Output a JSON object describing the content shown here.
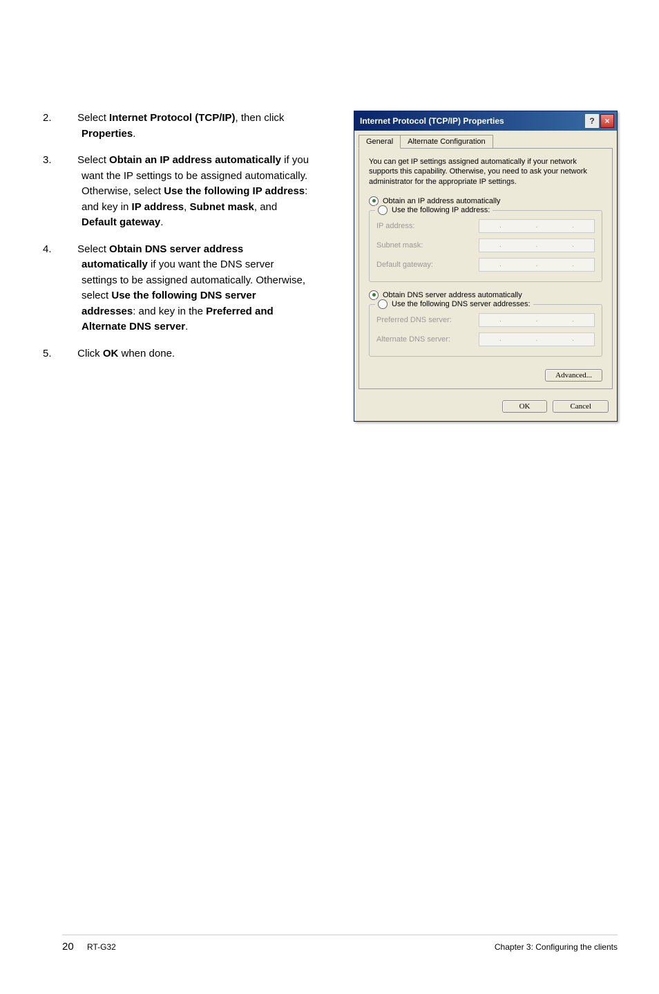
{
  "instructions": {
    "items": [
      {
        "num": "2.",
        "text": "Select <b>Internet Protocol (TCP/IP)</b>, then click <b>Properties</b>."
      },
      {
        "num": "3.",
        "text": "Select <b>Obtain an IP address automatically</b> if you want the IP settings to be assigned automatically. Otherwise, select <b>Use the following IP address</b>: and key in <b>IP address</b>, <b>Subnet mask</b>, and <b>Default gateway</b>."
      },
      {
        "num": "4.",
        "text": "Select <b>Obtain DNS server address automatically</b> if you want the DNS server settings to be assigned automatically. Otherwise, select <b>Use the following DNS server addresses</b>: and key in the <b>Preferred and Alternate DNS server</b>."
      },
      {
        "num": "5.",
        "text": "Click <b>OK</b> when done."
      }
    ]
  },
  "dialog": {
    "title": "Internet Protocol (TCP/IP) Properties",
    "help_btn": "?",
    "close_btn": "×",
    "tabs": [
      "General",
      "Alternate Configuration"
    ],
    "active_tab": 0,
    "description": "You can get IP settings assigned automatically if your network supports this capability. Otherwise, you need to ask your network administrator for the appropriate IP settings.",
    "ip_radio_auto": "Obtain an IP address automatically",
    "ip_radio_manual": "Use the following IP address:",
    "ip_fields": {
      "ip_address": "IP address:",
      "subnet_mask": "Subnet mask:",
      "default_gateway": "Default gateway:"
    },
    "dns_radio_auto": "Obtain DNS server address automatically",
    "dns_radio_manual": "Use the following DNS server addresses:",
    "dns_fields": {
      "preferred": "Preferred DNS server:",
      "alternate": "Alternate DNS server:"
    },
    "advanced_btn": "Advanced...",
    "ok_btn": "OK",
    "cancel_btn": "Cancel"
  },
  "footer": {
    "page": "20",
    "model": "RT-G32",
    "chapter": "Chapter 3: Configuring the clients"
  }
}
